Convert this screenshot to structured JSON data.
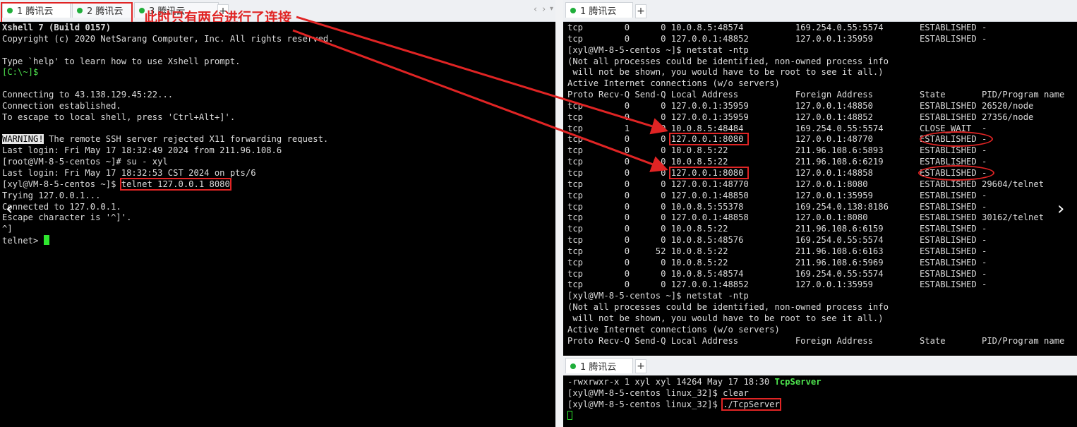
{
  "annotation": "此时只有两台进行了连接",
  "left": {
    "tabs": [
      {
        "label": "1 腾讯云"
      },
      {
        "label": "2 腾讯云"
      },
      {
        "label": "3 腾讯云"
      }
    ],
    "nav": {
      "prev": "‹",
      "next": "›",
      "menu": "▾"
    },
    "lines": [
      "Xshell 7 (Build 0157)",
      "Copyright (c) 2020 NetSarang Computer, Inc. All rights reserved.",
      "",
      "Type `help' to learn how to use Xshell prompt.",
      "[C:\\~]$",
      "",
      "Connecting to 43.138.129.45:22...",
      "Connection established.",
      "To escape to local shell, press 'Ctrl+Alt+]'.",
      "",
      "The remote SSH server rejected X11 forwarding request.",
      "Last login: Fri May 17 18:32:49 2024 from 211.96.108.6",
      "[root@VM-8-5-centos ~]# su - xyl",
      "Last login: Fri May 17 18:32:53 CST 2024 on pts/6",
      "[xyl@VM-8-5-centos ~]$ ",
      "Trying 127.0.0.1...",
      "Connected to 127.0.0.1.",
      "Escape character is '^]'.",
      "^]",
      "telnet> "
    ],
    "warning_label": "WARNING!",
    "telnet_cmd": "telnet 127.0.0.1 8080"
  },
  "top_right": {
    "tab": "1 腾讯云",
    "lines": [
      "tcp        0      0 10.0.8.5:48574          169.254.0.55:5574       ESTABLISHED -",
      "tcp        0      0 127.0.0.1:48852         127.0.0.1:35959         ESTABLISHED -",
      "[xyl@VM-8-5-centos ~]$ netstat -ntp",
      "(Not all processes could be identified, non-owned process info",
      " will not be shown, you would have to be root to see it all.)",
      "Active Internet connections (w/o servers)",
      "Proto Recv-Q Send-Q Local Address           Foreign Address         State       PID/Program name",
      "tcp        0      0 127.0.0.1:35959         127.0.0.1:48850         ESTABLISHED 26520/node",
      "tcp        0      0 127.0.0.1:35959         127.0.0.1:48852         ESTABLISHED 27356/node",
      "tcp        1      0 10.0.8.5:48484          169.254.0.55:5574       CLOSE_WAIT  -",
      "tcp        0      0 127.0.0.1:8080          127.0.0.1:48770         ESTABLISHED -",
      "tcp        0      0 10.0.8.5:22             211.96.108.6:5893       ESTABLISHED -",
      "tcp        0      0 10.0.8.5:22             211.96.108.6:6219       ESTABLISHED -",
      "tcp        0      0 127.0.0.1:8080          127.0.0.1:48858         ESTABLISHED -",
      "tcp        0      0 127.0.0.1:48770         127.0.0.1:8080          ESTABLISHED 29604/telnet",
      "tcp        0      0 127.0.0.1:48850         127.0.0.1:35959         ESTABLISHED -",
      "tcp        0      0 10.0.8.5:55378          169.254.0.138:8186      ESTABLISHED -",
      "tcp        0      0 127.0.0.1:48858         127.0.0.1:8080          ESTABLISHED 30162/telnet",
      "tcp        0      0 10.0.8.5:22             211.96.108.6:6159       ESTABLISHED -",
      "tcp        0      0 10.0.8.5:48576          169.254.0.55:5574       ESTABLISHED -",
      "tcp        0     52 10.0.8.5:22             211.96.108.6:6163       ESTABLISHED -",
      "tcp        0      0 10.0.8.5:22             211.96.108.6:5969       ESTABLISHED -",
      "tcp        0      0 10.0.8.5:48574          169.254.0.55:5574       ESTABLISHED -",
      "tcp        0      0 127.0.0.1:48852         127.0.0.1:35959         ESTABLISHED -",
      "[xyl@VM-8-5-centos ~]$ netstat -ntp",
      "(Not all processes could be identified, non-owned process info",
      " will not be shown, you would have to be root to see it all.)",
      "Active Internet connections (w/o servers)",
      "Proto Recv-Q Send-Q Local Address           Foreign Address         State       PID/Program name"
    ]
  },
  "bottom_right": {
    "tab": "1 腾讯云",
    "ls_prefix": "-rwxrwxr-x 1 xyl xyl 14264 May 17 18:30 ",
    "ls_file": "TcpServer",
    "clear_line": "[xyl@VM-8-5-centos linux_32]$ clear",
    "prompt": "[xyl@VM-8-5-centos linux_32]$ ",
    "run_cmd": "./TcpServer"
  },
  "colors": {
    "highlight": "#e02424",
    "prompt_green": "#4ee44e",
    "dot": "#1fae3a"
  }
}
